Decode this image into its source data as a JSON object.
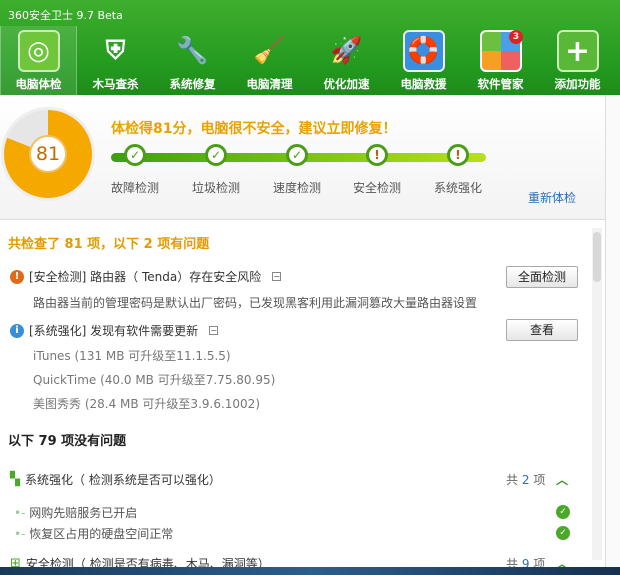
{
  "window": {
    "title": "360安全卫士 9.7 Beta"
  },
  "nav": [
    {
      "label": "电脑体检",
      "icon": "radar-icon",
      "active": true
    },
    {
      "label": "木马查杀",
      "icon": "shield-horse-icon"
    },
    {
      "label": "系统修复",
      "icon": "wrench-icon"
    },
    {
      "label": "电脑清理",
      "icon": "broom-icon"
    },
    {
      "label": "优化加速",
      "icon": "rocket-icon"
    },
    {
      "label": "电脑救援",
      "icon": "lifebuoy-monitor-icon"
    },
    {
      "label": "软件管家",
      "icon": "software-grid-icon",
      "badge": "3"
    },
    {
      "label": "添加功能",
      "icon": "plus-icon"
    }
  ],
  "score": {
    "value": "81",
    "fraction": 0.81,
    "headline": "体检得81分，电脑很不安全，建议立即修复！",
    "recheck": "重新体检"
  },
  "steps": [
    {
      "label": "故障检测",
      "status": "ok"
    },
    {
      "label": "垃圾检测",
      "status": "ok"
    },
    {
      "label": "速度检测",
      "status": "ok"
    },
    {
      "label": "安全检测",
      "status": "warn"
    },
    {
      "label": "系统强化",
      "status": "warn"
    }
  ],
  "summary": "共检查了 81 项，以下 2 项有问题",
  "issues": [
    {
      "title": "[安全检测] 路由器（ Tenda）存在安全风险",
      "desc": "路由器当前的管理密码是默认出厂密码，已发现黑客利用此漏洞篡改大量路由器设置",
      "button": "全面检测"
    },
    {
      "title": "[系统强化] 发现有软件需要更新",
      "button": "查看",
      "updates": [
        "iTunes (131 MB 可升级至11.1.5.5)",
        "QuickTime (40.0 MB 可升级至7.75.80.95)",
        "美图秀秀 (28.4 MB 可升级至3.9.6.1002)"
      ]
    }
  ],
  "ok_header": "以下 79 项没有问题",
  "groups": [
    {
      "title": "系统强化（ 检测系统是否可以强化）",
      "count_prefix": "共",
      "count": "2",
      "count_suffix": "项",
      "items": [
        "网购先赔服务已开启",
        "恢复区占用的硬盘空间正常"
      ]
    },
    {
      "title": "安全检测（ 检测是否有病毒、木马、漏洞等）",
      "count_prefix": "共",
      "count": "9",
      "count_suffix": "项"
    }
  ]
}
